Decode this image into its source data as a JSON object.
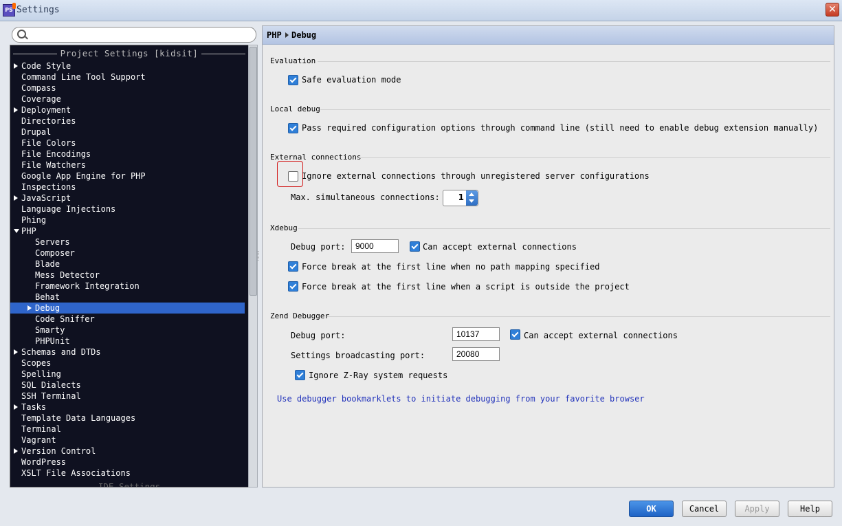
{
  "window": {
    "title": "Settings"
  },
  "search": {
    "placeholder": ""
  },
  "tree": {
    "header": "Project Settings [kidsit]",
    "items": [
      {
        "label": "Code Style",
        "arrow": "right",
        "level": 0
      },
      {
        "label": "Command Line Tool Support",
        "level": 0
      },
      {
        "label": "Compass",
        "level": 0
      },
      {
        "label": "Coverage",
        "level": 0
      },
      {
        "label": "Deployment",
        "arrow": "right",
        "level": 0
      },
      {
        "label": "Directories",
        "level": 0
      },
      {
        "label": "Drupal",
        "level": 0
      },
      {
        "label": "File Colors",
        "level": 0
      },
      {
        "label": "File Encodings",
        "level": 0
      },
      {
        "label": "File Watchers",
        "level": 0
      },
      {
        "label": "Google App Engine for PHP",
        "level": 0
      },
      {
        "label": "Inspections",
        "level": 0
      },
      {
        "label": "JavaScript",
        "arrow": "right",
        "level": 0
      },
      {
        "label": "Language Injections",
        "level": 0
      },
      {
        "label": "Phing",
        "level": 0
      },
      {
        "label": "PHP",
        "arrow": "down",
        "level": 0
      },
      {
        "label": "Servers",
        "level": 1
      },
      {
        "label": "Composer",
        "level": 1
      },
      {
        "label": "Blade",
        "level": 1
      },
      {
        "label": "Mess Detector",
        "level": 1
      },
      {
        "label": "Framework Integration",
        "level": 1
      },
      {
        "label": "Behat",
        "level": 1
      },
      {
        "label": "Debug",
        "arrow": "right",
        "level": 1,
        "selected": true
      },
      {
        "label": "Code Sniffer",
        "level": 1
      },
      {
        "label": "Smarty",
        "level": 1
      },
      {
        "label": "PHPUnit",
        "level": 1
      },
      {
        "label": "Schemas and DTDs",
        "arrow": "right",
        "level": 0
      },
      {
        "label": "Scopes",
        "level": 0
      },
      {
        "label": "Spelling",
        "level": 0
      },
      {
        "label": "SQL Dialects",
        "level": 0
      },
      {
        "label": "SSH Terminal",
        "level": 0
      },
      {
        "label": "Tasks",
        "arrow": "right",
        "level": 0
      },
      {
        "label": "Template Data Languages",
        "level": 0
      },
      {
        "label": "Terminal",
        "level": 0
      },
      {
        "label": "Vagrant",
        "level": 0
      },
      {
        "label": "Version Control",
        "arrow": "right",
        "level": 0
      },
      {
        "label": "WordPress",
        "level": 0
      },
      {
        "label": "XSLT File Associations",
        "level": 0
      }
    ],
    "footer": "IDE Settings"
  },
  "breadcrumb": {
    "parent": "PHP",
    "current": "Debug"
  },
  "evaluation": {
    "title": "Evaluation",
    "safe_mode_label": "Safe evaluation mode",
    "safe_mode_checked": true
  },
  "local_debug": {
    "title": "Local debug",
    "pass_options_label": "Pass required configuration options through command line (still need to enable debug extension manually)",
    "pass_options_checked": true
  },
  "external": {
    "title": "External connections",
    "ignore_label": "Ignore external connections through unregistered server configurations",
    "ignore_checked": false,
    "max_label": "Max. simultaneous connections:",
    "max_value": "1"
  },
  "xdebug": {
    "title": "Xdebug",
    "port_label": "Debug port:",
    "port_value": "9000",
    "accept_label": "Can accept external connections",
    "force_no_mapping_label": "Force break at the first line when no path mapping specified",
    "force_outside_label": "Force break at the first line when a script is outside the project"
  },
  "zend": {
    "title": "Zend Debugger",
    "port_label": "Debug port:",
    "port_value": "10137",
    "accept_label": "Can accept external connections",
    "broadcast_label": "Settings broadcasting port:",
    "broadcast_value": "20080",
    "zray_label": "Ignore Z-Ray system requests"
  },
  "link_text": "Use debugger bookmarklets to initiate debugging from your favorite browser",
  "buttons": {
    "ok": "OK",
    "cancel": "Cancel",
    "apply": "Apply",
    "help": "Help"
  },
  "colors": {
    "accent": "#2f65ca",
    "tree_bg": "#0f1120",
    "link": "#2233bb",
    "highlight": "#d21b1b"
  }
}
